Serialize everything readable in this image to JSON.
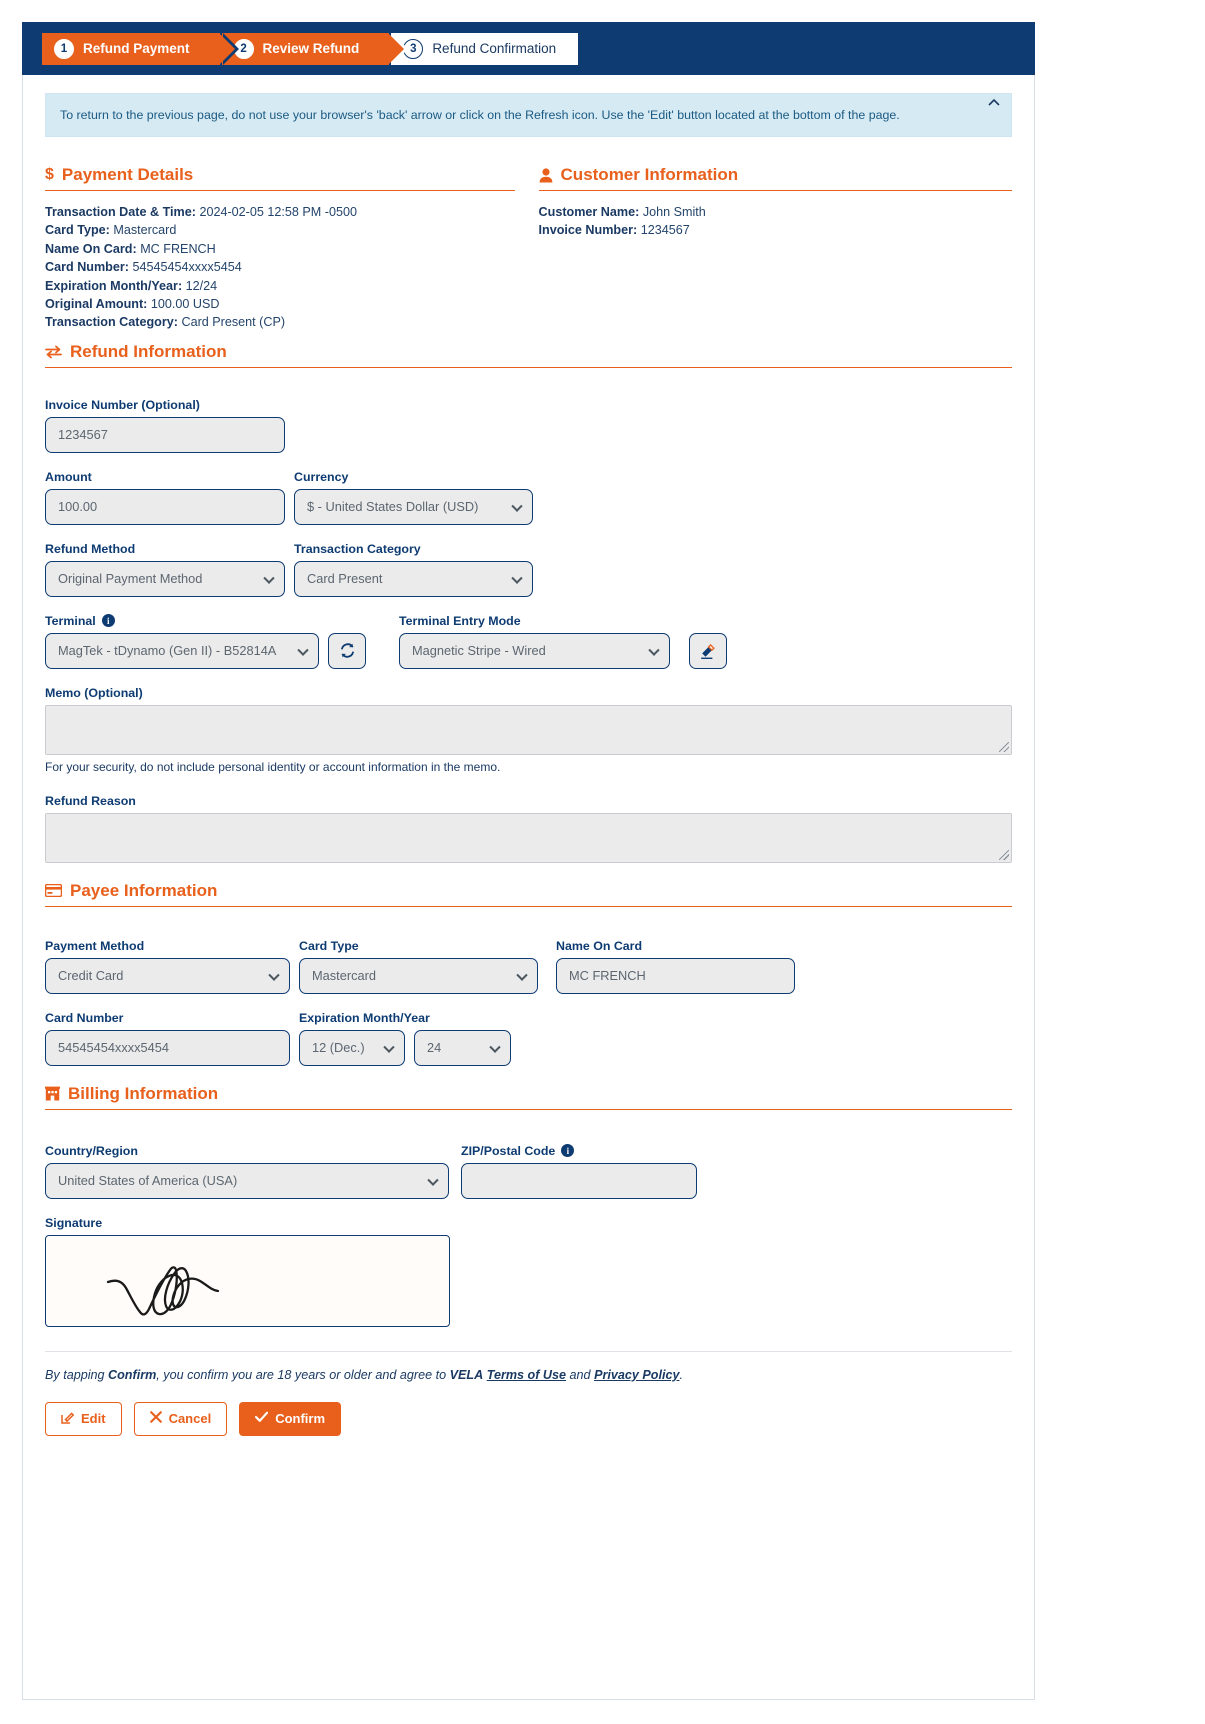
{
  "stepper": {
    "steps": [
      {
        "num": "1",
        "label": "Refund Payment",
        "state": "done"
      },
      {
        "num": "2",
        "label": "Review Refund",
        "state": "current"
      },
      {
        "num": "3",
        "label": "Refund Confirmation",
        "state": "todo"
      }
    ]
  },
  "banner": {
    "text": "To return to the previous page, do not use your browser's 'back' arrow or click on the Refresh icon. Use the 'Edit' button located at the bottom of the page.",
    "collapse_icon": "chevron-up-icon"
  },
  "payment_details": {
    "title": "Payment Details",
    "icon": "dollar-icon",
    "fields": [
      {
        "label": "Transaction Date & Time:",
        "value": "2024-02-05 12:58 PM -0500"
      },
      {
        "label": "Card Type:",
        "value": "Mastercard"
      },
      {
        "label": "Name On Card:",
        "value": "MC FRENCH"
      },
      {
        "label": "Card Number:",
        "value": "54545454xxxx5454"
      },
      {
        "label": "Expiration Month/Year:",
        "value": "12/24"
      },
      {
        "label": "Original Amount:",
        "value": "100.00 USD"
      },
      {
        "label": "Transaction Category:",
        "value": "Card Present (CP)"
      }
    ]
  },
  "customer_information": {
    "title": "Customer Information",
    "icon": "user-icon",
    "fields": [
      {
        "label": "Customer Name:",
        "value": "John Smith"
      },
      {
        "label": "Invoice Number:",
        "value": "1234567"
      }
    ]
  },
  "refund_information": {
    "title": "Refund Information",
    "icon": "exchange-icon",
    "invoice_number": {
      "label": "Invoice Number (Optional)",
      "value": "1234567"
    },
    "amount": {
      "label": "Amount",
      "value": "100.00"
    },
    "currency": {
      "label": "Currency",
      "value": "$ - United States Dollar (USD)"
    },
    "refund_method": {
      "label": "Refund Method",
      "value": "Original Payment Method"
    },
    "transaction_category": {
      "label": "Transaction Category",
      "value": "Card Present"
    },
    "terminal": {
      "label": "Terminal",
      "value": "MagTek - tDynamo (Gen II) - B52814A",
      "info_icon": "info-icon",
      "refresh_icon": "refresh-icon"
    },
    "terminal_entry_mode": {
      "label": "Terminal Entry Mode",
      "value": "Magnetic Stripe - Wired",
      "swipe_icon": "card-swipe-icon"
    },
    "memo": {
      "label": "Memo (Optional)",
      "value": "",
      "hint": "For your security, do not include personal identity or account information in the memo."
    },
    "refund_reason": {
      "label": "Refund Reason",
      "value": ""
    }
  },
  "payee_information": {
    "title": "Payee Information",
    "icon": "credit-card-icon",
    "payment_method": {
      "label": "Payment Method",
      "value": "Credit Card"
    },
    "card_type": {
      "label": "Card Type",
      "value": "Mastercard"
    },
    "name_on_card": {
      "label": "Name On Card",
      "value": "MC FRENCH"
    },
    "card_number": {
      "label": "Card Number",
      "value": "54545454xxxx5454"
    },
    "expiration": {
      "label": "Expiration Month/Year",
      "month": "12 (Dec.)",
      "year": "24"
    }
  },
  "billing_information": {
    "title": "Billing Information",
    "icon": "building-icon",
    "country_region": {
      "label": "Country/Region",
      "value": "United States of America (USA)"
    },
    "zip_postal": {
      "label": "ZIP/Postal Code",
      "value": "",
      "info_icon": "info-icon"
    },
    "signature": {
      "label": "Signature",
      "alt": "handwritten signature reading Vela"
    }
  },
  "footer": {
    "terms_prefix": "By tapping ",
    "terms_confirm": "Confirm",
    "terms_middle": ", you confirm you are 18 years or older and agree to ",
    "terms_brand": "VELA",
    "terms_link1": "Terms of Use",
    "terms_and": " and ",
    "terms_link2": "Privacy Policy",
    "terms_end": ".",
    "edit_label": "Edit",
    "cancel_label": "Cancel",
    "confirm_label": "Confirm"
  },
  "colors": {
    "accent_orange": "#e8601c",
    "navy": "#0d3b72",
    "banner_blue": "#d6eaf4",
    "control_grey": "#ebebeb"
  }
}
